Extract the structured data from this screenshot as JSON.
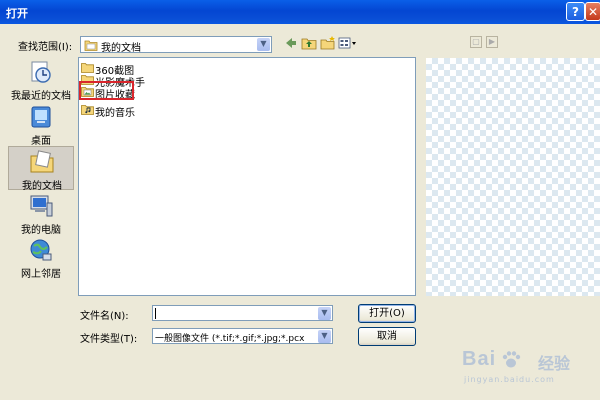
{
  "window": {
    "title": "打开",
    "help_label": "?",
    "close_label": "✕"
  },
  "toolbar": {
    "look_in_label": "查找范围(I):",
    "look_in_value": "我的文档",
    "icons": [
      "back-icon",
      "up-folder-icon",
      "new-folder-icon",
      "views-menu-icon"
    ]
  },
  "places": [
    {
      "label": "我最近的文档",
      "icon": "recent-documents-icon"
    },
    {
      "label": "桌面",
      "icon": "desktop-icon"
    },
    {
      "label": "我的文档",
      "icon": "my-documents-icon",
      "selected": true
    },
    {
      "label": "我的电脑",
      "icon": "my-computer-icon"
    },
    {
      "label": "网上邻居",
      "icon": "network-places-icon"
    }
  ],
  "files": [
    {
      "name": "360截图",
      "icon": "folder-icon"
    },
    {
      "name": "光影魔术手",
      "icon": "folder-icon"
    },
    {
      "name": "图片收藏",
      "icon": "picture-folder-icon",
      "highlighted": true
    },
    {
      "name": "我的音乐",
      "icon": "music-folder-icon"
    }
  ],
  "form": {
    "filename_label": "文件名(N):",
    "filename_value": "",
    "filetype_label": "文件类型(T):",
    "filetype_value": "一般图像文件 (*.tif;*.gif;*.jpg;*.pcx"
  },
  "buttons": {
    "open_label": "打开(O)",
    "cancel_label": "取消"
  },
  "watermark": {
    "brand": "Bai",
    "suffix": "经验",
    "url": "jingyan.baidu.com"
  },
  "colors": {
    "titlebar": "#0a4fd6",
    "highlight": "#d9262c",
    "dialog_bg": "#ece9d8"
  }
}
